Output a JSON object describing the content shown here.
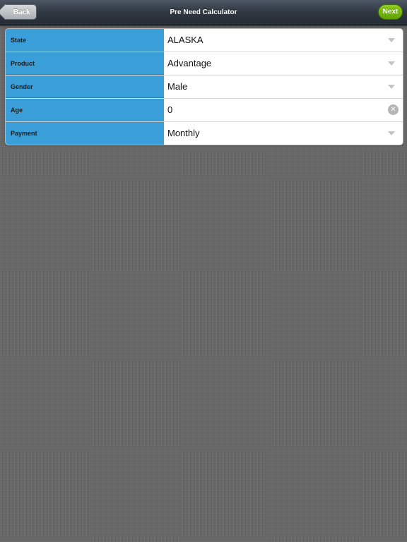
{
  "navbar": {
    "title": "Pre Need Calculator",
    "back_label": "Back",
    "next_label": "Next",
    "next_color": "#6bb30b"
  },
  "form": {
    "label_color": "#3a9fd8",
    "rows": [
      {
        "label": "State",
        "value": "ALASKA",
        "control": "dropdown",
        "icon": "chevron-down-icon"
      },
      {
        "label": "Product",
        "value": "Advantage",
        "control": "dropdown",
        "icon": "chevron-down-icon"
      },
      {
        "label": "Gender",
        "value": "Male",
        "control": "dropdown",
        "icon": "chevron-down-icon"
      },
      {
        "label": "Age",
        "value": "0",
        "control": "text-input",
        "icon": "clear-icon",
        "icon_glyph": "✕"
      },
      {
        "label": "Payment",
        "value": "Monthly",
        "control": "dropdown",
        "icon": "chevron-down-icon"
      }
    ]
  }
}
